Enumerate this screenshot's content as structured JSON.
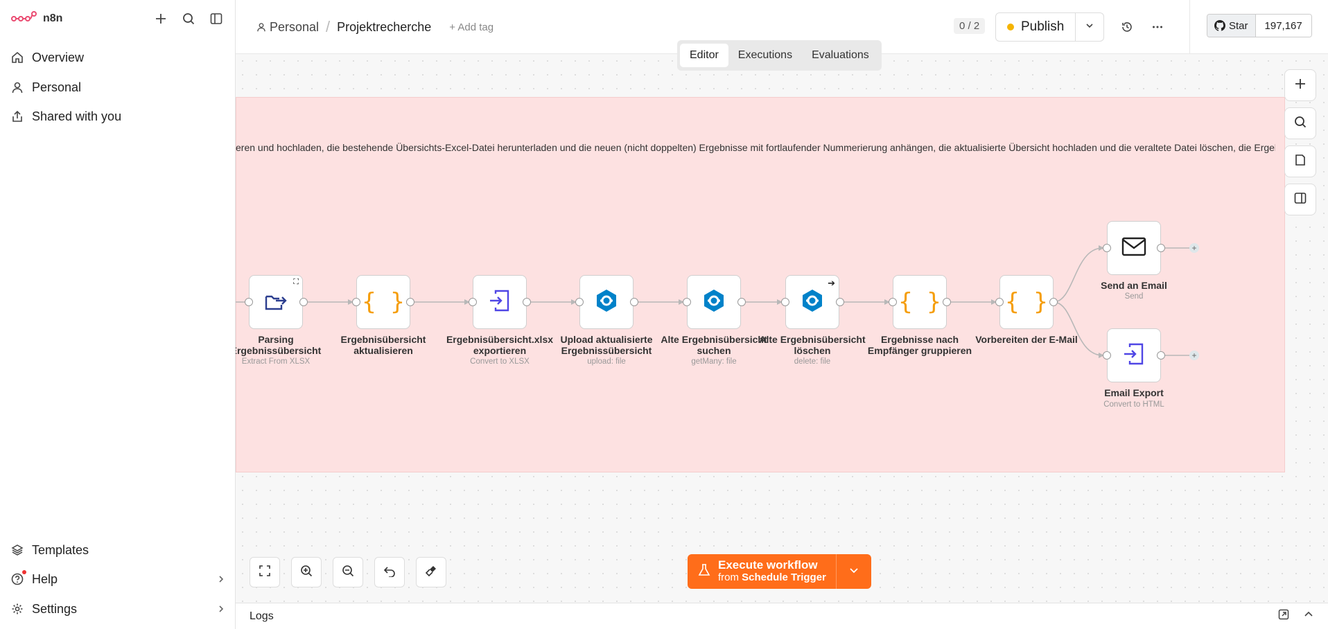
{
  "app": {
    "logo_text": "n8n"
  },
  "sidebar": {
    "items": [
      {
        "label": "Overview",
        "icon": "home-icon"
      },
      {
        "label": "Personal",
        "icon": "user-icon"
      },
      {
        "label": "Shared with you",
        "icon": "share-icon"
      }
    ],
    "bottom": [
      {
        "label": "Templates",
        "icon": "templates-icon"
      },
      {
        "label": "Help",
        "icon": "help-icon"
      },
      {
        "label": "Settings",
        "icon": "settings-icon"
      }
    ]
  },
  "header": {
    "project": "Personal",
    "workflow_name": "Projektrecherche",
    "add_tag": "+ Add tag",
    "counter": "0 / 2",
    "publish_label": "Publish",
    "github_star": "Star",
    "github_count": "197,167"
  },
  "tabs": [
    {
      "label": "Editor",
      "active": true
    },
    {
      "label": "Executions",
      "active": false
    },
    {
      "label": "Evaluations",
      "active": false
    }
  ],
  "canvas": {
    "sticky_text": "eren und hochladen, die bestehende Übersichts-Excel-Datei herunterladen und die neuen (nicht doppelten) Ergebnisse mit fortlaufender Nummerierung anhängen, die aktualisierte Übersicht hochladen und die veraltete Datei löschen, die Ergebnisse",
    "nodes": [
      {
        "title1": "Parsing",
        "title2": "Ergebnissübersicht",
        "subtitle": "Extract From XLSX",
        "icon": "extract-icon"
      },
      {
        "title1": "Ergebnisübersicht",
        "title2": "aktualisieren",
        "subtitle": "",
        "icon": "code-icon"
      },
      {
        "title1": "Ergebnisübersicht.xlsx",
        "title2": "exportieren",
        "subtitle": "Convert to XLSX",
        "icon": "convert-icon"
      },
      {
        "title1": "Upload aktualisierte",
        "title2": "Ergebnissübersicht",
        "subtitle": "upload: file",
        "icon": "nextcloud-icon"
      },
      {
        "title1": "Alte Ergebnisübersicht",
        "title2": "suchen",
        "subtitle": "getMany: file",
        "icon": "nextcloud-icon"
      },
      {
        "title1": "Alte Ergebnisübersicht",
        "title2": "löschen",
        "subtitle": "delete: file",
        "icon": "nextcloud-icon"
      },
      {
        "title1": "Ergebnisse nach",
        "title2": "Empfänger gruppieren",
        "subtitle": "",
        "icon": "code-icon"
      },
      {
        "title1": "Vorbereiten der E-Mail",
        "title2": "",
        "subtitle": "",
        "icon": "code-icon"
      },
      {
        "title1": "Send an Email",
        "title2": "",
        "subtitle": "Send",
        "icon": "mail-icon"
      },
      {
        "title1": "Email Export",
        "title2": "",
        "subtitle": "Convert to HTML",
        "icon": "convert-icon"
      }
    ]
  },
  "execute": {
    "label": "Execute workflow",
    "sub_prefix": "from",
    "sub_trigger": "Schedule Trigger"
  },
  "logs": {
    "label": "Logs"
  },
  "colors": {
    "accent": "#ff6d1a",
    "sticky": "#fde1e1",
    "code": "#f59e0b",
    "nextcloud": "#0082c9",
    "convert": "#4f46e5"
  }
}
